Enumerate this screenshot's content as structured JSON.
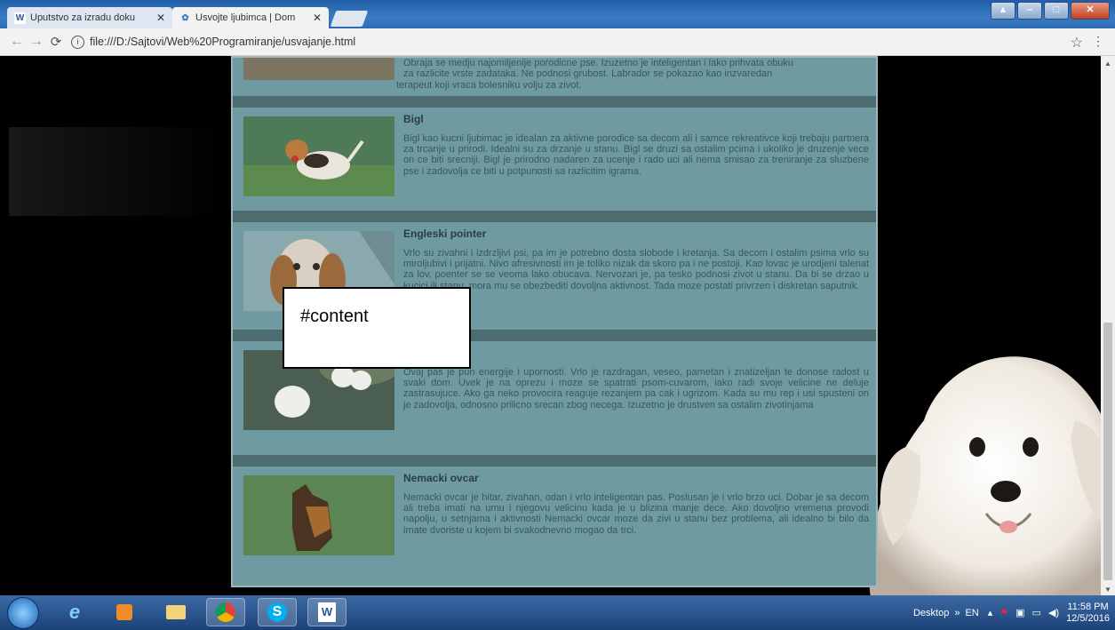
{
  "browser": {
    "tabs": [
      {
        "title": "Uputstvo za izradu doku",
        "icon": "word-icon"
      },
      {
        "title": "Usvojte ljubimca | Dom",
        "icon": "paw-icon"
      }
    ],
    "url": "file:///D:/Sajtovi/Web%20Programiranje/usvajanje.html"
  },
  "page": {
    "top_fragment": {
      "line1": "Obraja se medju najomiljenije porodicne pse. Izuzetno je inteligentan i lako prihvata obuku",
      "line2": "za razlicite vrste zadataka. Ne podnosi grubost. Labrador se pokazao kao inzvaredan",
      "line3": "terapeut koji vraca bolesniku volju za zivot."
    },
    "articles": [
      {
        "title": "Bigl",
        "text": "Bigl kao kucni ljubimac je idealan za aktivne porodice sa decom ali i samce rekreativce koji trebaju partnera za trcanje u prirodi. Idealni su za drzanje u stanu. Bigl se druzi sa ostalim pcima i ukoliko je druzenje vece on ce biti srecniji. Bigl je prirodno nadaren za ucenje i rado uci ali nema smisao za treniranje za sluzbene pse i zadovolja ce biti u potpunosti sa razlicitim igrama."
      },
      {
        "title": "Engleski pointer",
        "text": "Vrlo su zivahni i izdrzljivi psi, pa im je potrebno dosta slobode i kretanja. Sa decom i ostalim psima vrlo su miroljubivi i prijatni. Nivo afresivnosti im je toliko nizak da skoro pa i ne postoji. Kao lovac je urodjeni talenat za lov, poenter se se veoma lako obucava. Nervozan je, pa tesko podnosi zivot u stanu. Da bi se drzao u kucici ili stanu, mora mu se obezbediti dovoljna aktivnost. Tada moze postati privrzen i diskretan saputnik."
      },
      {
        "title": "Beli terijer",
        "text": "Ovaj pas je pun energije i upornosti. Vrlo je razdragan, veseo, pametan i znatizeljan te donose radost u svaki dom. Uvek je na oprezu i moze se spatrati psom-cuvarom, iako radi svoje velicine ne deluje zastrasujuce. Ako ga neko provocira reaguje rezanjem pa cak i ugrizom. Kada su mu rep i usi spusteni on je zadovolja, odnosno prilicno srecan zbog necega. Izuzetno je drustven sa ostalim zivotinjama"
      },
      {
        "title": "Nemacki ovcar",
        "text": "Nemacki ovcar je hitar, zivahan, odan i vrlo inteligentan pas. Poslusan je i vrlo brzo uci. Dobar je sa decom ali treba imati na umu i njegovu velicinu kada je u blizina manje dece. Ako dovoljno vremena provodi napolju, u setnjama i aktivnosti Nemacki ovcar moze da zivi u stanu bez problema, ali idealno bi bilo da imate dvoriste u kojem bi svakodnevno mogao da trci."
      }
    ],
    "overlay_label": "#content"
  },
  "taskbar": {
    "desktop_label": "Desktop",
    "chevron": "»",
    "lang": "EN",
    "time": "11:58 PM",
    "date": "12/5/2016"
  }
}
